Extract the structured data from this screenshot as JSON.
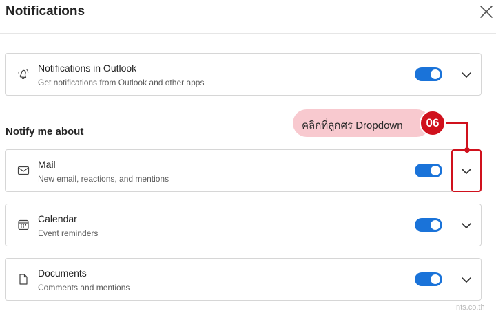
{
  "header": {
    "title": "Notifications"
  },
  "outlook_card": {
    "name": "Notifications in Outlook",
    "description": "Get notifications from Outlook and other apps",
    "enabled": true,
    "icon": "bell-ringing-icon"
  },
  "section": {
    "title": "Notify me about"
  },
  "items": [
    {
      "name": "Mail",
      "description": "New email, reactions, and mentions",
      "enabled": true,
      "icon": "mail-icon"
    },
    {
      "name": "Calendar",
      "description": "Event reminders",
      "enabled": true,
      "icon": "calendar-icon"
    },
    {
      "name": "Documents",
      "description": "Comments and mentions",
      "enabled": true,
      "icon": "document-icon"
    }
  ],
  "annotation": {
    "text": "คลิกที่ลูกศร Dropdown",
    "step": "06",
    "color": "#d0111d"
  },
  "colors": {
    "toggle_on": "#1a73d9",
    "callout_bg": "#f8c9cf"
  },
  "watermark": "nts.co.th"
}
